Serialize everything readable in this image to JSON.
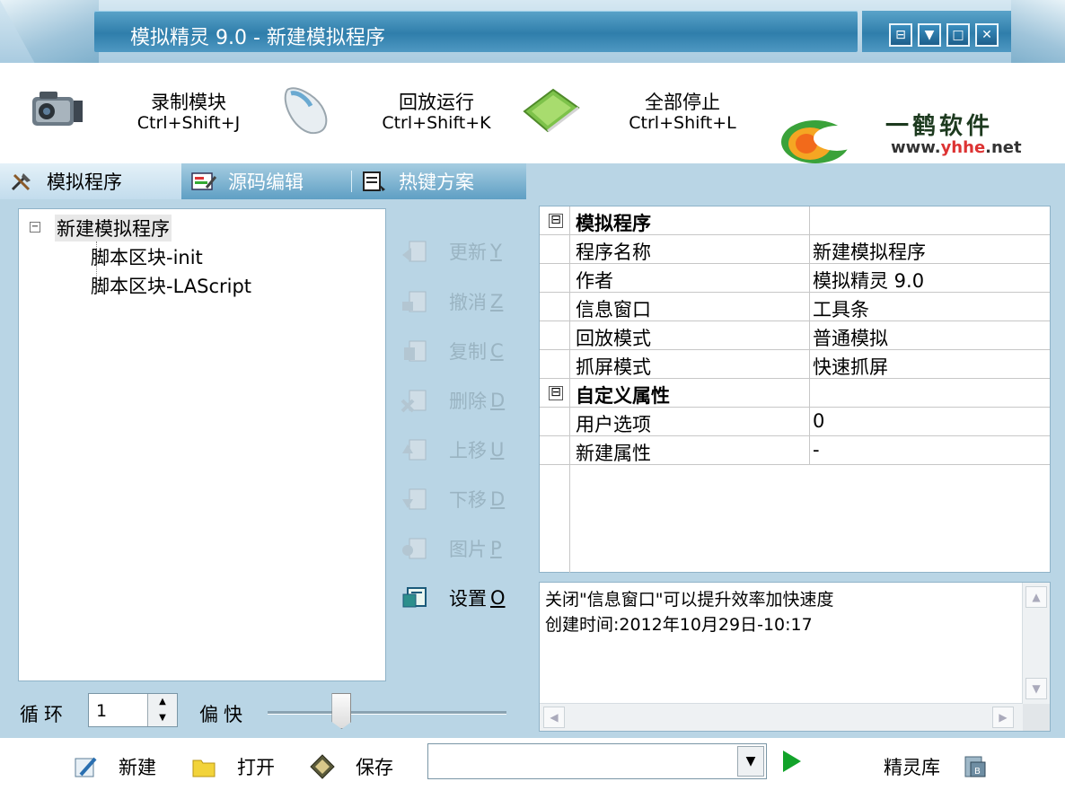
{
  "window": {
    "title": "模拟精灵 9.0 - 新建模拟程序",
    "controls": [
      "⊟",
      "▼",
      "□",
      "✕"
    ]
  },
  "toolbar": {
    "record": {
      "label": "录制模块",
      "hotkey": "Ctrl+Shift+J",
      "icon": "camcorder-icon"
    },
    "playback": {
      "label": "回放运行",
      "hotkey": "Ctrl+Shift+K",
      "icon": "mouse-icon"
    },
    "stop": {
      "label": "全部停止",
      "hotkey": "Ctrl+Shift+L",
      "icon": "green-card-icon"
    },
    "logo": {
      "text": "一鹤软件",
      "url_prefix": "www.",
      "url_brand": "yhhe",
      "url_suffix": ".net"
    }
  },
  "tabs": [
    {
      "label": "模拟程序",
      "icon": "tools-icon",
      "active": true
    },
    {
      "label": "源码编辑",
      "icon": "edit-icon",
      "active": false
    },
    {
      "label": "热键方案",
      "icon": "hotkey-icon",
      "active": false
    }
  ],
  "tree": {
    "root": "新建模拟程序",
    "children": [
      "脚本区块-init",
      "脚本区块-LAScript"
    ]
  },
  "actions": [
    {
      "label": "更新",
      "key": "Y",
      "enabled": false
    },
    {
      "label": "撤消",
      "key": "Z",
      "enabled": false
    },
    {
      "label": "复制",
      "key": "C",
      "enabled": false
    },
    {
      "label": "删除",
      "key": "D",
      "enabled": false
    },
    {
      "label": "上移",
      "key": "U",
      "enabled": false
    },
    {
      "label": "下移",
      "key": "D",
      "enabled": false
    },
    {
      "label": "图片",
      "key": "P",
      "enabled": false
    },
    {
      "label": "设置",
      "key": "O",
      "enabled": true
    }
  ],
  "properties": {
    "cat1": {
      "title": "模拟程序",
      "toggle": "⊟"
    },
    "rows1": [
      {
        "key": "程序名称",
        "value": "新建模拟程序"
      },
      {
        "key": "作者",
        "value": "模拟精灵 9.0"
      },
      {
        "key": "信息窗口",
        "value": "工具条"
      },
      {
        "key": "回放模式",
        "value": "普通模拟"
      },
      {
        "key": "抓屏模式",
        "value": "快速抓屏"
      }
    ],
    "cat2": {
      "title": "自定义属性",
      "toggle": "⊟"
    },
    "rows2": [
      {
        "key": "用户选项",
        "value": "0"
      },
      {
        "key": "新建属性",
        "value": "-"
      }
    ]
  },
  "info": {
    "line1": "关闭\"信息窗口\"可以提升效率加快速度",
    "line2": "创建时间:2012年10月29日-10:17"
  },
  "loop": {
    "label": "循环",
    "value": "1"
  },
  "speed": {
    "label": "偏快",
    "level": 0.31
  },
  "bottom": {
    "new_label": "新建",
    "open_label": "打开",
    "save_label": "保存",
    "combo_value": "",
    "library_label": "精灵库"
  },
  "colors": {
    "accent": "#2f7eab",
    "play": "#12a32a"
  }
}
